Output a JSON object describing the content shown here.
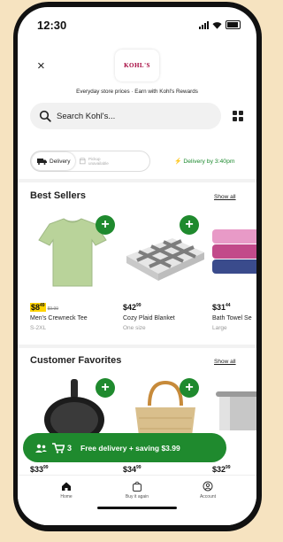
{
  "status_bar": {
    "time": "12:30"
  },
  "header": {
    "brand_logo": "KOHL'S",
    "close_icon": "×"
  },
  "tagline": "Everyday store prices · Earn with Kohl's Rewards",
  "search": {
    "placeholder": "Search Kohl's..."
  },
  "fulfillment": {
    "delivery_label": "Delivery",
    "pickup_label": "Pickup unavailable",
    "eta": "Delivery by 3:40pm"
  },
  "best_sellers": {
    "title": "Best Sellers",
    "show_all": "Show all",
    "items": [
      {
        "price_dollars": "$8",
        "price_cents": "49",
        "was_price": "$9.99",
        "name": "Men's Crewneck Tee",
        "size": "S-2XL"
      },
      {
        "price_dollars": "$42",
        "price_cents": "99",
        "name": "Cozy Plaid Blanket",
        "size": "One size"
      },
      {
        "price_dollars": "$31",
        "price_cents": "44",
        "name": "Bath Towel Se",
        "size": "Large"
      }
    ]
  },
  "customer_favorites": {
    "title": "Customer Favorites",
    "show_all": "Show all",
    "items": [
      {
        "price_dollars": "$33",
        "price_cents": "99"
      },
      {
        "price_dollars": "$34",
        "price_cents": "99"
      },
      {
        "price_dollars": "$32",
        "price_cents": "99"
      }
    ]
  },
  "cart_banner": {
    "count": "3",
    "message": "Free delivery + saving $3.99"
  },
  "tab_bar": {
    "home": "Home",
    "buy_again": "Buy it again",
    "account": "Account"
  },
  "colors": {
    "accent_green": "#1f8a2e",
    "brand_red": "#a30039",
    "sale_yellow": "#ffd400"
  }
}
